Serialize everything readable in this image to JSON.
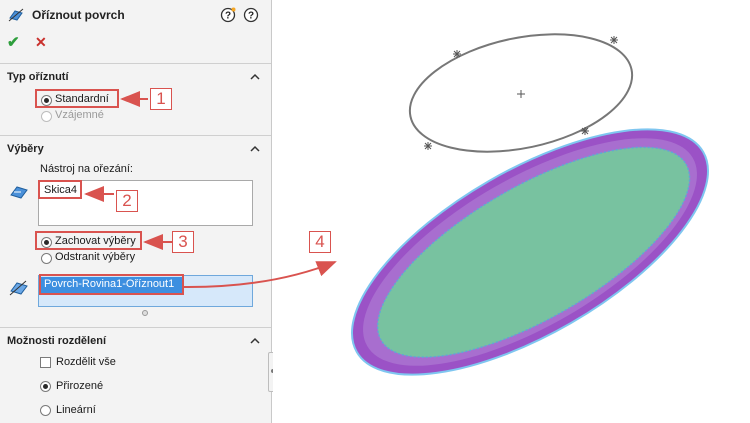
{
  "panel": {
    "title": "Oříznout povrch",
    "ok_glyph": "✔",
    "cancel_glyph": "✕",
    "help_glyph": "?"
  },
  "trim_type": {
    "heading": "Typ oříznutí",
    "options": [
      "Standardní",
      "Vzájemné"
    ],
    "selected": "Standardní"
  },
  "selections": {
    "heading": "Výběry",
    "trim_tool_label": "Nástroj na ořezání:",
    "trim_tool_items": [
      "Skica4"
    ],
    "keep_options": [
      "Zachovat výběry",
      "Odstranit výběry"
    ],
    "keep_selected": "Zachovat výběry",
    "pieces_items": [
      "Povrch-Rovina1-Oříznout1"
    ]
  },
  "split_options": {
    "heading": "Možnosti rozdělení",
    "split_all": "Rozdělit vše",
    "options": [
      "Přirozené",
      "Lineární"
    ],
    "selected": "Přirozené"
  },
  "callouts": [
    "1",
    "2",
    "3",
    "4"
  ],
  "colors": {
    "accent_red": "#d9534f",
    "selection_blue": "#3d8fe0",
    "surface_green": "#78c2a0",
    "surface_purple": "#9b52c6"
  },
  "icons": [
    "trim-surface-icon",
    "help-icon",
    "ok-icon",
    "cancel-icon",
    "chevron-up-icon",
    "sketch-selection-icon",
    "surface-selection-icon"
  ]
}
